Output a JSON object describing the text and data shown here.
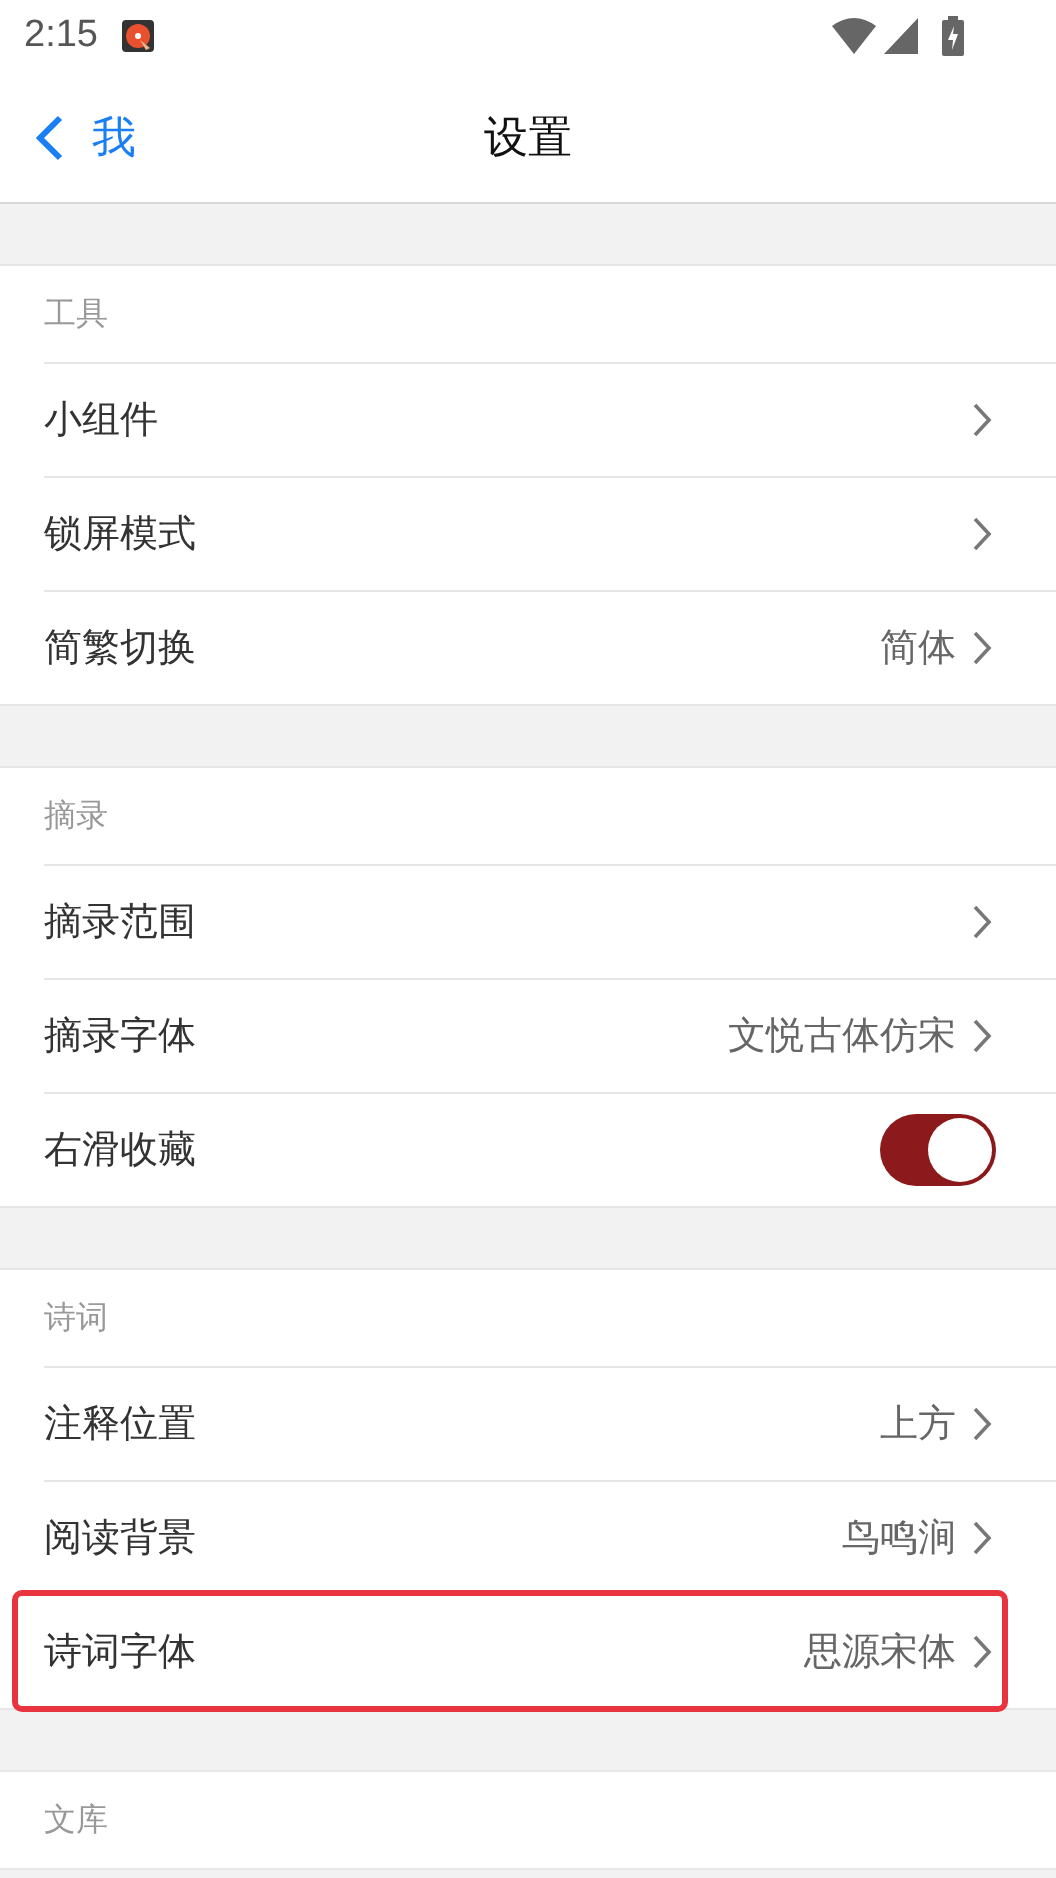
{
  "status_bar": {
    "time": "2:15"
  },
  "nav_bar": {
    "back_label": "我",
    "title": "设置"
  },
  "sections": [
    {
      "header": "工具",
      "items": [
        {
          "kind": "link",
          "label": "小组件",
          "highlighted": false
        },
        {
          "kind": "link",
          "label": "锁屏模式",
          "highlighted": false
        },
        {
          "kind": "link",
          "label": "简繁切换",
          "value": "简体",
          "highlighted": false
        }
      ]
    },
    {
      "header": "摘录",
      "items": [
        {
          "kind": "link",
          "label": "摘录范围",
          "highlighted": false
        },
        {
          "kind": "link",
          "label": "摘录字体",
          "value": "文悦古体仿宋",
          "highlighted": false
        },
        {
          "kind": "toggle",
          "label": "右滑收藏",
          "on": true,
          "highlighted": false
        }
      ]
    },
    {
      "header": "诗词",
      "items": [
        {
          "kind": "link",
          "label": "注释位置",
          "value": "上方",
          "highlighted": false
        },
        {
          "kind": "link",
          "label": "阅读背景",
          "value": "鸟鸣涧",
          "highlighted": false
        },
        {
          "kind": "link",
          "label": "诗词字体",
          "value": "思源宋体",
          "highlighted": true
        }
      ]
    },
    {
      "header": "文库"
    }
  ]
}
